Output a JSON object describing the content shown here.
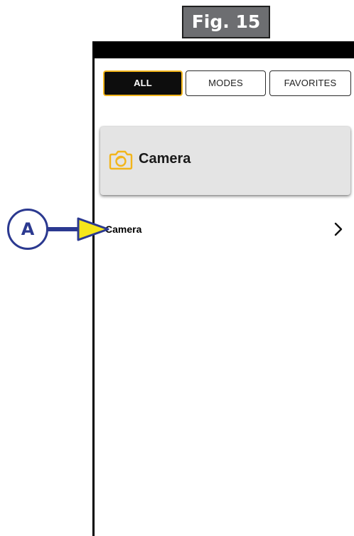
{
  "figure": {
    "label": "Fig. 15"
  },
  "tabs": [
    {
      "label": "ALL",
      "active": true
    },
    {
      "label": "MODES",
      "active": false
    },
    {
      "label": "FAVORITES",
      "active": false
    }
  ],
  "card": {
    "title": "Camera",
    "icon": "camera-icon"
  },
  "list": [
    {
      "label": "Camera",
      "icon": "chevron-right-icon"
    }
  ],
  "callout": {
    "letter": "A"
  },
  "colors": {
    "accent": "#f2b51b",
    "callout": "#2b3990",
    "arrow_fill": "#f5e61b",
    "figure_bg": "#6d6e71"
  }
}
